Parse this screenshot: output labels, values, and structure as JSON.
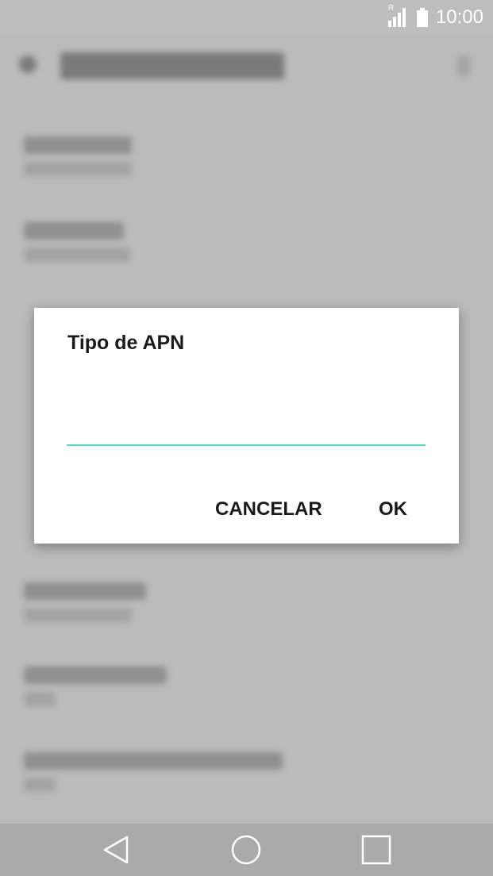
{
  "status_bar": {
    "time": "10:00",
    "roaming_indicator": "R",
    "signal_icon": "signal-icon",
    "battery_icon": "battery-icon"
  },
  "dialog": {
    "title": "Tipo de APN",
    "input_value": "",
    "cancel_label": "CANCELAR",
    "ok_label": "OK",
    "accent_color": "#5fd6c3"
  },
  "nav_bar": {
    "back_icon": "back-triangle-icon",
    "home_icon": "home-circle-icon",
    "recents_icon": "recents-square-icon"
  }
}
